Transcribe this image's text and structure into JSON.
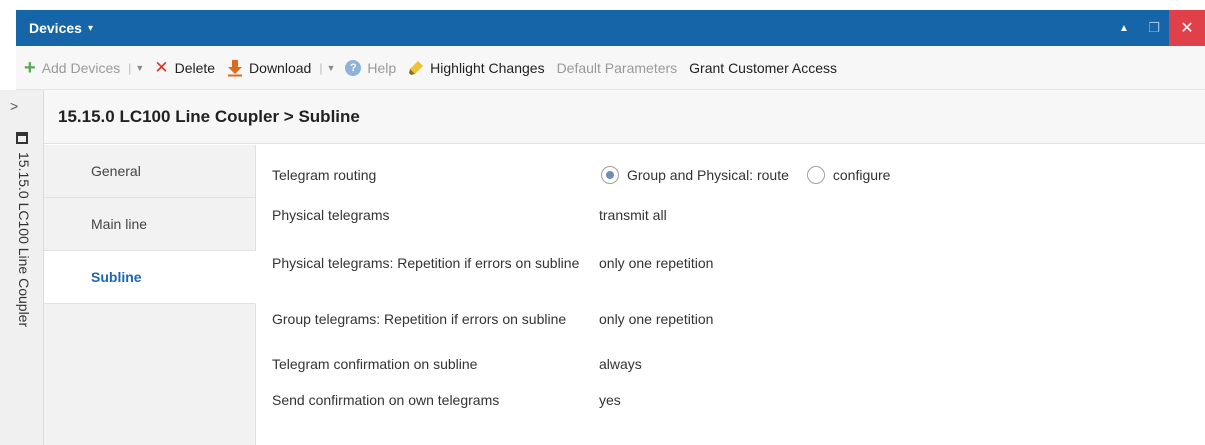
{
  "titlebar": {
    "title": "Devices",
    "caret": "▾",
    "minimize": "▲",
    "restore": "❐",
    "close": "✕"
  },
  "toolbar": {
    "add_devices": "Add Devices",
    "delete": "Delete",
    "download": "Download",
    "help": "Help",
    "highlight_changes": "Highlight Changes",
    "default_parameters": "Default Parameters",
    "grant_customer_access": "Grant Customer Access"
  },
  "sidebar": {
    "expand": ">",
    "device_label": "15.15.0 LC100 Line Coupler"
  },
  "header": {
    "breadcrumb": "15.15.0 LC100 Line Coupler > Subline"
  },
  "nav": {
    "items": [
      {
        "label": "General"
      },
      {
        "label": "Main line"
      },
      {
        "label": "Subline",
        "active": true
      }
    ]
  },
  "params": {
    "rows": [
      {
        "label": "Telegram routing",
        "options": [
          {
            "label": "Group and Physical: route",
            "checked": true
          },
          {
            "label": "configure",
            "checked": false
          }
        ]
      },
      {
        "label": "Physical telegrams",
        "value": "transmit all"
      },
      {
        "label": "Physical telegrams: Repetition if errors on subline",
        "value": "only one repetition"
      },
      {
        "label": "Group telegrams: Repetition if errors on subline",
        "value": "only one repetition"
      },
      {
        "label": "Telegram confirmation on subline",
        "value": "always"
      },
      {
        "label": "Send confirmation on own telegrams",
        "value": "yes"
      }
    ]
  },
  "colors": {
    "titlebar": "#1565a8",
    "active_tab_text": "#1b68b0",
    "close_button": "#e0404a"
  }
}
